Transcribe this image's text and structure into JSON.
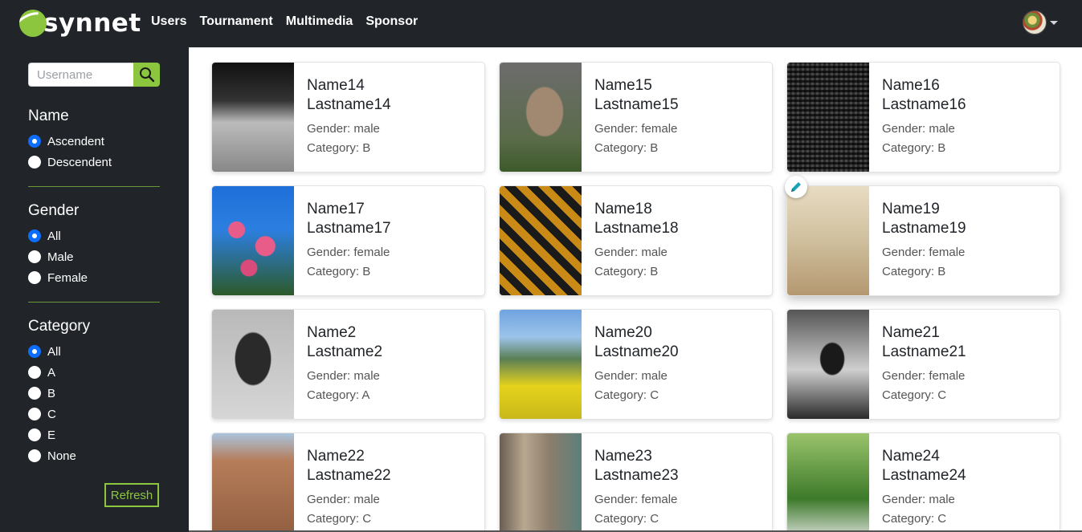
{
  "app": {
    "logo_text": "synnet"
  },
  "nav": {
    "links": [
      "Users",
      "Tournament",
      "Multimedia",
      "Sponsor"
    ]
  },
  "sidebar": {
    "search": {
      "placeholder": "Username",
      "value": ""
    },
    "name_section": {
      "title": "Name",
      "options": [
        {
          "label": "Ascendent",
          "checked": true
        },
        {
          "label": "Descendent",
          "checked": false
        }
      ]
    },
    "gender_section": {
      "title": "Gender",
      "options": [
        {
          "label": "All",
          "checked": true
        },
        {
          "label": "Male",
          "checked": false
        },
        {
          "label": "Female",
          "checked": false
        }
      ]
    },
    "category_section": {
      "title": "Category",
      "options": [
        {
          "label": "All",
          "checked": true
        },
        {
          "label": "A",
          "checked": false
        },
        {
          "label": "B",
          "checked": false
        },
        {
          "label": "C",
          "checked": false
        },
        {
          "label": "E",
          "checked": false
        },
        {
          "label": "None",
          "checked": false
        }
      ]
    },
    "refresh_label": "Refresh"
  },
  "users": [
    {
      "first": "Name14",
      "last": "Lastname14",
      "gender": "Gender: male",
      "category": "Category: B"
    },
    {
      "first": "Name15",
      "last": "Lastname15",
      "gender": "Gender: female",
      "category": "Category: B"
    },
    {
      "first": "Name16",
      "last": "Lastname16",
      "gender": "Gender: male",
      "category": "Category: B"
    },
    {
      "first": "Name17",
      "last": "Lastname17",
      "gender": "Gender: female",
      "category": "Category: B"
    },
    {
      "first": "Name18",
      "last": "Lastname18",
      "gender": "Gender: male",
      "category": "Category: B"
    },
    {
      "first": "Name19",
      "last": "Lastname19",
      "gender": "Gender: female",
      "category": "Category: B"
    },
    {
      "first": "Name2",
      "last": "Lastname2",
      "gender": "Gender: male",
      "category": "Category: A"
    },
    {
      "first": "Name20",
      "last": "Lastname20",
      "gender": "Gender: male",
      "category": "Category: C"
    },
    {
      "first": "Name21",
      "last": "Lastname21",
      "gender": "Gender: female",
      "category": "Category: C"
    },
    {
      "first": "Name22",
      "last": "Lastname22",
      "gender": "Gender: male",
      "category": "Category: C"
    },
    {
      "first": "Name23",
      "last": "Lastname23",
      "gender": "Gender: female",
      "category": "Category: C"
    },
    {
      "first": "Name24",
      "last": "Lastname24",
      "gender": "Gender: male",
      "category": "Category: C"
    }
  ],
  "colors": {
    "accent": "#8cc63f",
    "dark": "#212529",
    "radio": "#0d6efd"
  },
  "icons": {
    "search": "search-icon",
    "edit": "pencil-icon",
    "caret": "chevron-down-icon"
  }
}
